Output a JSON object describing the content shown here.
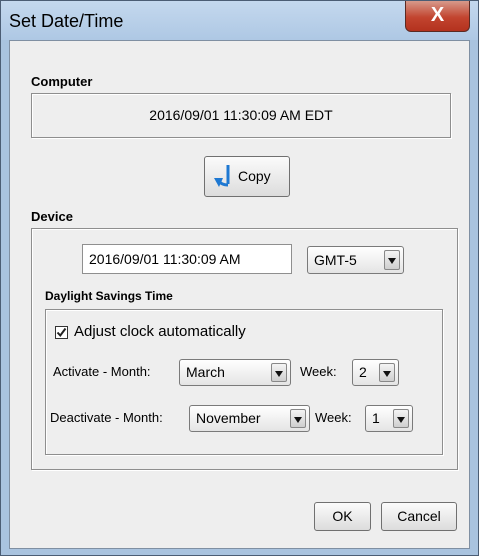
{
  "window": {
    "title": "Set Date/Time",
    "close_label": "X"
  },
  "computer": {
    "label": "Computer",
    "datetime": "2016/09/01 11:30:09 AM  EDT"
  },
  "copy_button": {
    "label": "Copy"
  },
  "device": {
    "label": "Device",
    "datetime_value": "2016/09/01 11:30:09 AM",
    "timezone": "GMT-5"
  },
  "dst": {
    "label": "Daylight Savings Time",
    "adjust_label": "Adjust clock automatically",
    "adjust_checked": true,
    "activate": {
      "label": "Activate  -  Month:",
      "month": "March",
      "week_label": "Week:",
      "week": "2"
    },
    "deactivate": {
      "label": "Deactivate - Month:",
      "month": "November",
      "week_label": "Week:",
      "week": "1"
    }
  },
  "buttons": {
    "ok": "OK",
    "cancel": "Cancel"
  },
  "colors": {
    "titlebar": "#aec8e4",
    "close_button": "#c2442f",
    "client_bg": "#eeeeee",
    "copy_arrow": "#1e78d2"
  },
  "icons": {
    "copy": "arrow-down-icon",
    "close": "close-icon",
    "check": "checkmark-icon",
    "dropdown": "chevron-down-icon"
  }
}
